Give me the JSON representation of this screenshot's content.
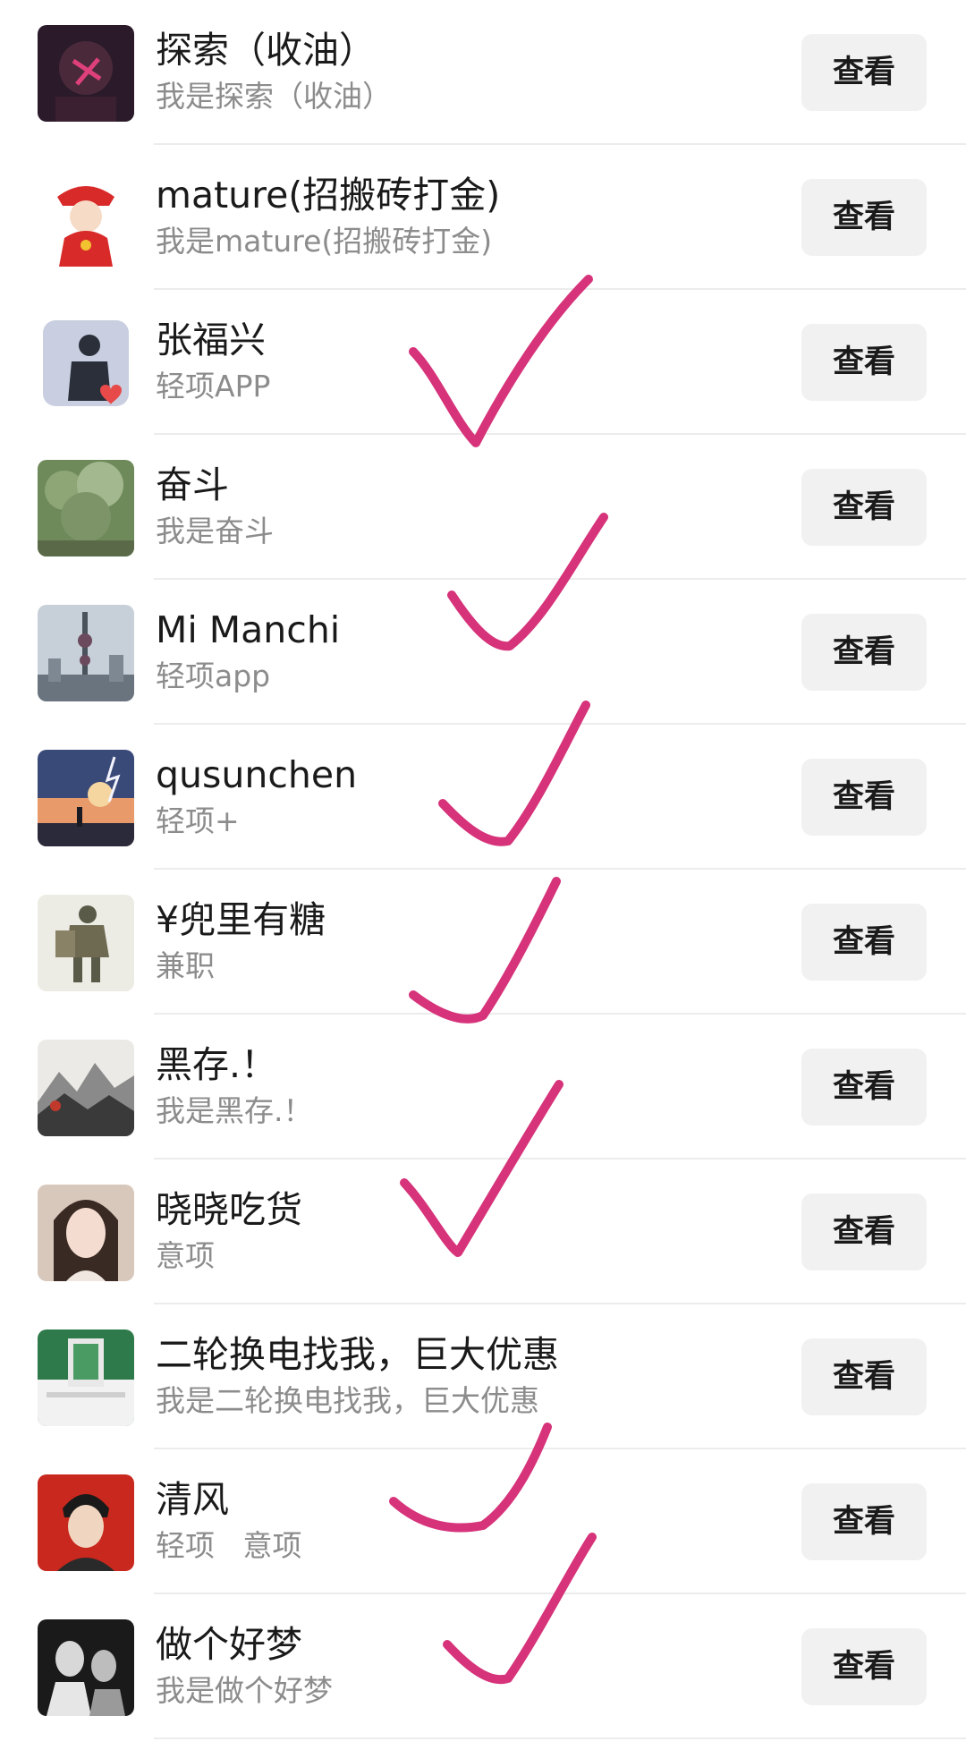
{
  "contacts": [
    {
      "name": "探索（收油）",
      "subtitle": "我是探索（收油）",
      "button": "查看",
      "avatar_bg": "#2a1a2a",
      "avatar_fg": "#e0407a"
    },
    {
      "name": "mature(招搬砖打金)",
      "subtitle": "我是mature(招搬砖打金)",
      "button": "查看",
      "avatar_bg": "#ffffff",
      "avatar_fg": "#d92a2a"
    },
    {
      "name": "张福兴",
      "subtitle": "轻项APP",
      "button": "查看",
      "avatar_bg": "#c9cfe0",
      "avatar_fg": "#2a2f3a"
    },
    {
      "name": "奋斗",
      "subtitle": "我是奋斗",
      "button": "查看",
      "avatar_bg": "#6f8a5a",
      "avatar_fg": "#c9d4b8"
    },
    {
      "name": "Mi Manchi",
      "subtitle": "轻项app",
      "button": "查看",
      "avatar_bg": "#b9c2cc",
      "avatar_fg": "#4a525c"
    },
    {
      "name": "qusunchen",
      "subtitle": "轻项+",
      "button": "查看",
      "avatar_bg": "#3a4a78",
      "avatar_fg": "#f2b47a"
    },
    {
      "name": "¥兜里有糖",
      "subtitle": "兼职",
      "button": "查看",
      "avatar_bg": "#ecece4",
      "avatar_fg": "#5a5a48"
    },
    {
      "name": "黑存.！",
      "subtitle": "我是黑存.！",
      "button": "查看",
      "avatar_bg": "#e8e4e0",
      "avatar_fg": "#3a3a3a"
    },
    {
      "name": "晓晓吃货",
      "subtitle": "意项",
      "button": "查看",
      "avatar_bg": "#d8c8bc",
      "avatar_fg": "#3a2a24"
    },
    {
      "name": "二轮换电找我，巨大优惠",
      "subtitle": "我是二轮换电找我，巨大优惠",
      "button": "查看",
      "avatar_bg": "#2f7a4a",
      "avatar_fg": "#f2f2f2"
    },
    {
      "name": "清风",
      "subtitle": "轻项   意项",
      "button": "查看",
      "avatar_bg": "#c8281e",
      "avatar_fg": "#f0d6c0"
    },
    {
      "name": "做个好梦",
      "subtitle": "我是做个好梦",
      "button": "查看",
      "avatar_bg": "#1a1a1a",
      "avatar_fg": "#d8d8d8"
    }
  ],
  "annotation": {
    "mark": "check-mark",
    "color": "#d6337a",
    "marked_rows": [
      2,
      3,
      4,
      5,
      6,
      7,
      8,
      9,
      10,
      11
    ]
  }
}
